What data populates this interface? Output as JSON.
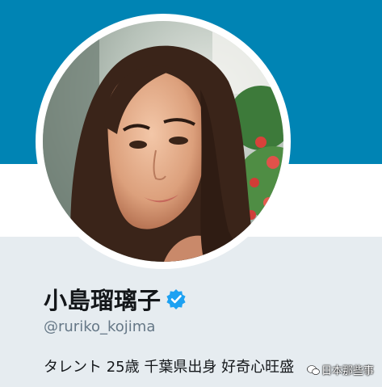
{
  "profile": {
    "name": "小島瑠璃子",
    "handle": "@ruriko_kojima",
    "bio": "タレント 25歳 千葉県出身 好奇心旺盛",
    "verified": true
  },
  "watermark": {
    "text": "日本那些事"
  },
  "colors": {
    "banner": "#0084b4",
    "page_background": "#e6ecf0",
    "verified_badge": "#1da1f2",
    "handle_text": "#657786",
    "name_text": "#14171a"
  },
  "icons": {
    "verified": "verified-check-icon",
    "watermark": "wechat-logo-icon"
  }
}
